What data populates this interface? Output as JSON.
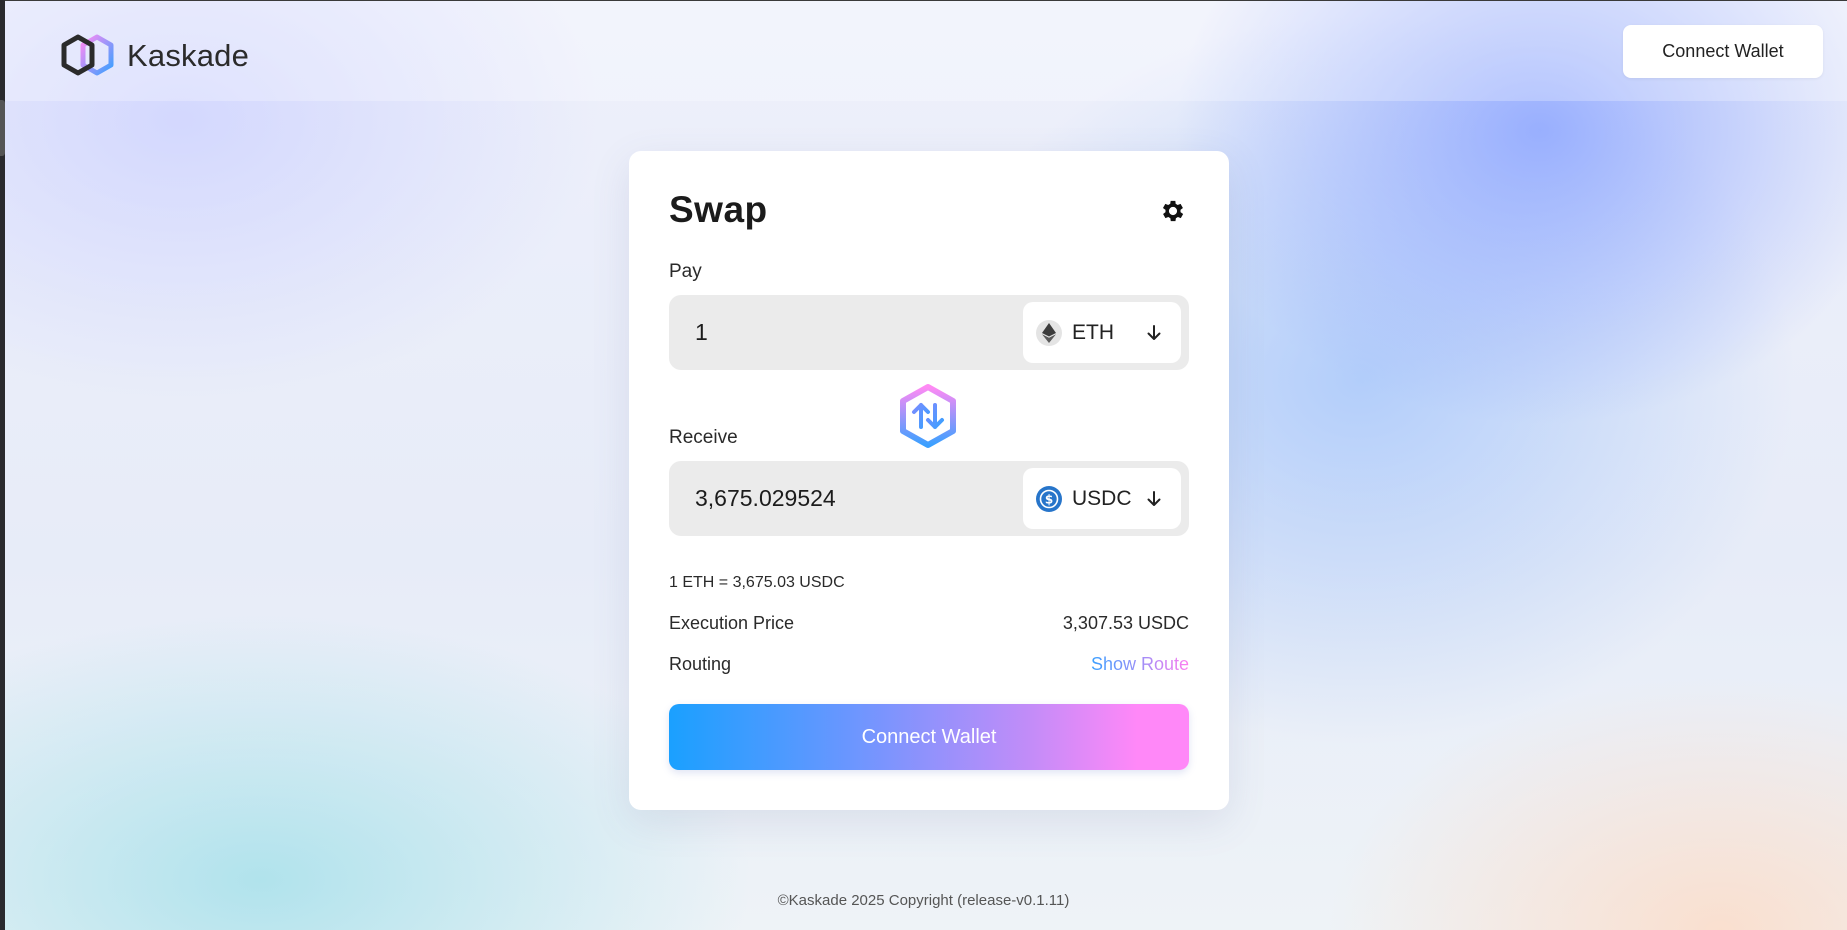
{
  "header": {
    "brand_name": "Kaskade",
    "connect_wallet_label": "Connect Wallet"
  },
  "swap": {
    "title": "Swap",
    "pay": {
      "label": "Pay",
      "amount": "1",
      "token": "ETH",
      "token_icon": "ethereum-icon"
    },
    "receive": {
      "label": "Receive",
      "amount": "3,675.029524",
      "token": "USDC",
      "token_icon": "usdc-icon"
    },
    "rate_text": "1 ETH = 3,675.03 USDC",
    "execution_price": {
      "label": "Execution Price",
      "value": "3,307.53 USDC"
    },
    "routing": {
      "label": "Routing",
      "link_label": "Show Route"
    },
    "cta_label": "Connect Wallet"
  },
  "footer": {
    "text": "©Kaskade 2025 Copyright (release-v0.1.11)"
  },
  "colors": {
    "accent_blue": "#1aa0ff",
    "accent_pink": "#ff88f8",
    "usdc_blue": "#2775ca"
  }
}
